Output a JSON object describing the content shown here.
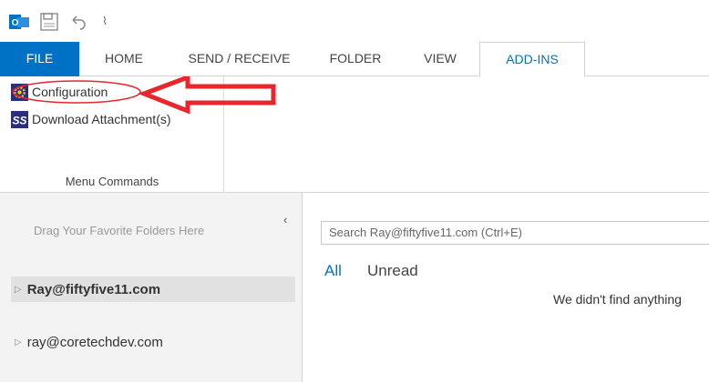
{
  "qat": {
    "dropdown_glyph": "⌇"
  },
  "tabs": [
    {
      "label": "FILE"
    },
    {
      "label": "HOME"
    },
    {
      "label": "SEND / RECEIVE"
    },
    {
      "label": "FOLDER"
    },
    {
      "label": "VIEW"
    },
    {
      "label": "ADD-INS"
    }
  ],
  "ribbon": {
    "commands": [
      {
        "label": "Configuration",
        "icon": "gear-icon"
      },
      {
        "label": "Download Attachment(s)",
        "icon": "ss-logo-icon"
      }
    ],
    "group_label": "Menu Commands"
  },
  "folder_pane": {
    "favorites_hint": "Drag Your Favorite Folders Here",
    "collapse_glyph": "‹",
    "accounts": [
      {
        "label": "Ray@fiftyfive11.com"
      },
      {
        "label": "ray@coretechdev.com"
      }
    ]
  },
  "mail_pane": {
    "search_placeholder": "Search Ray@fiftyfive11.com (Ctrl+E)",
    "filters": [
      {
        "label": "All"
      },
      {
        "label": "Unread"
      }
    ],
    "empty_message": "We didn't find anything"
  },
  "colors": {
    "accent": "#0072c6",
    "annotation": "#e8262b"
  }
}
